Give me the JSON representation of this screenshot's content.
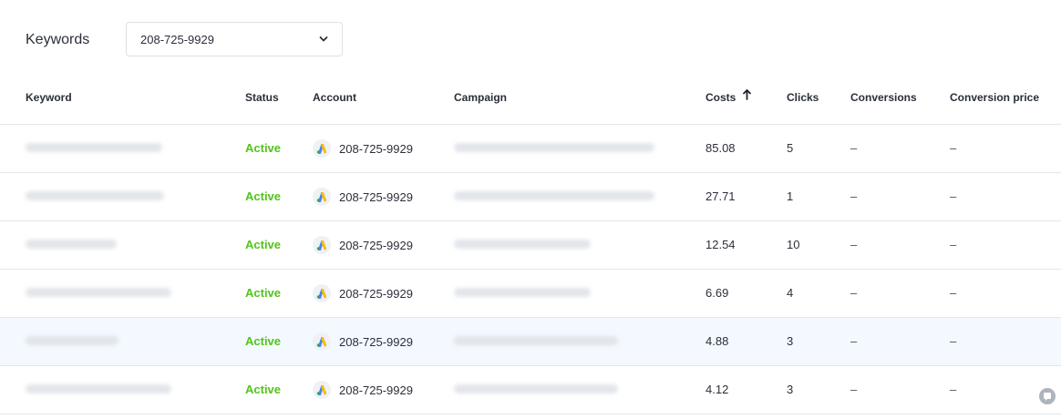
{
  "header": {
    "title": "Keywords",
    "account_select": {
      "value": "208-725-9929",
      "icon": "chevron-down-icon"
    }
  },
  "table": {
    "columns": {
      "keyword": "Keyword",
      "status": "Status",
      "account": "Account",
      "campaign": "Campaign",
      "costs": "Costs",
      "clicks": "Clicks",
      "conversions": "Conversions",
      "conversion_price": "Conversion price"
    },
    "sort": {
      "column": "costs",
      "icon": "arrow-up-icon"
    },
    "rows": [
      {
        "status": "Active",
        "account": "208-725-9929",
        "costs": "85.08",
        "clicks": "5",
        "conversions": "–",
        "conversion_price": "–"
      },
      {
        "status": "Active",
        "account": "208-725-9929",
        "costs": "27.71",
        "clicks": "1",
        "conversions": "–",
        "conversion_price": "–"
      },
      {
        "status": "Active",
        "account": "208-725-9929",
        "costs": "12.54",
        "clicks": "10",
        "conversions": "–",
        "conversion_price": "–"
      },
      {
        "status": "Active",
        "account": "208-725-9929",
        "costs": "6.69",
        "clicks": "4",
        "conversions": "–",
        "conversion_price": "–"
      },
      {
        "status": "Active",
        "account": "208-725-9929",
        "costs": "4.88",
        "clicks": "3",
        "conversions": "–",
        "conversion_price": "–"
      },
      {
        "status": "Active",
        "account": "208-725-9929",
        "costs": "4.12",
        "clicks": "3",
        "conversions": "–",
        "conversion_price": "–"
      }
    ]
  },
  "colors": {
    "status_active": "#52c41a",
    "row_highlight": "#f3f9fe",
    "google_ads_blue": "#4285f4",
    "google_ads_yellow": "#fbbc04",
    "google_ads_green": "#34a853"
  },
  "icons": {
    "account": "google-ads-icon",
    "support": "chat-icon"
  }
}
